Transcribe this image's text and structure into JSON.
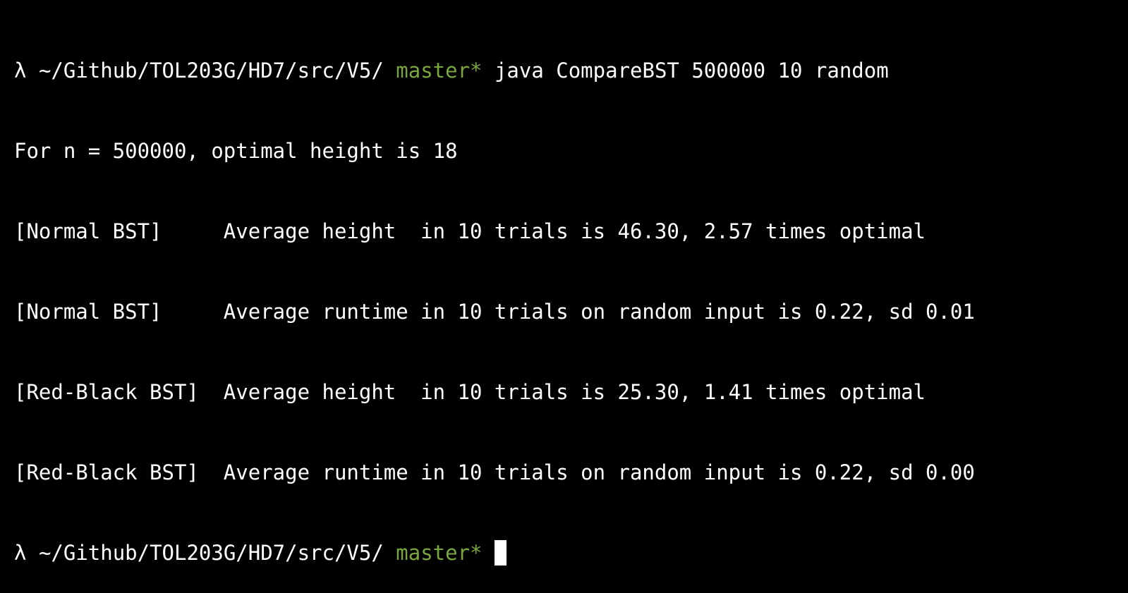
{
  "colors": {
    "background": "#000000",
    "text": "#ffffff",
    "branch": "#7aa640",
    "cursor": "#ffffff"
  },
  "terminal": {
    "prompt_symbol": "λ",
    "path": "~/Github/TOL203G/HD7/src/V5/",
    "branch": "master*",
    "command": "java CompareBST 500000 10 random",
    "output": [
      "For n = 500000, optimal height is 18",
      "[Normal BST]     Average height  in 10 trials is 46.30, 2.57 times optimal",
      "[Normal BST]     Average runtime in 10 trials on random input is 0.22, sd 0.01",
      "[Red-Black BST]  Average height  in 10 trials is 25.30, 1.41 times optimal",
      "[Red-Black BST]  Average runtime in 10 trials on random input is 0.22, sd 0.00"
    ]
  }
}
